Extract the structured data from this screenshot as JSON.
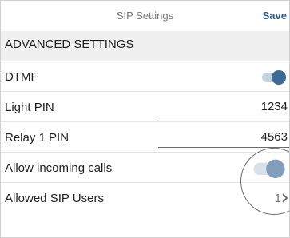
{
  "header": {
    "title": "SIP Settings",
    "save_label": "Save"
  },
  "section": {
    "title": "ADVANCED SETTINGS"
  },
  "rows": [
    {
      "label": "DTMF",
      "type": "toggle",
      "on": true
    },
    {
      "label": "Light PIN",
      "type": "input",
      "value": "1234"
    },
    {
      "label": "Relay 1 PIN",
      "type": "input",
      "value": "4563"
    },
    {
      "label": "Allow incoming calls",
      "type": "toggle",
      "on": true
    },
    {
      "label": "Allowed SIP Users",
      "type": "link",
      "value": "1"
    }
  ],
  "icons": {
    "chevron": "chevron-right-icon"
  },
  "colors": {
    "accent": "#3e6a98",
    "toggle_track": "#c4d2df",
    "save": "#2b5d8f"
  }
}
